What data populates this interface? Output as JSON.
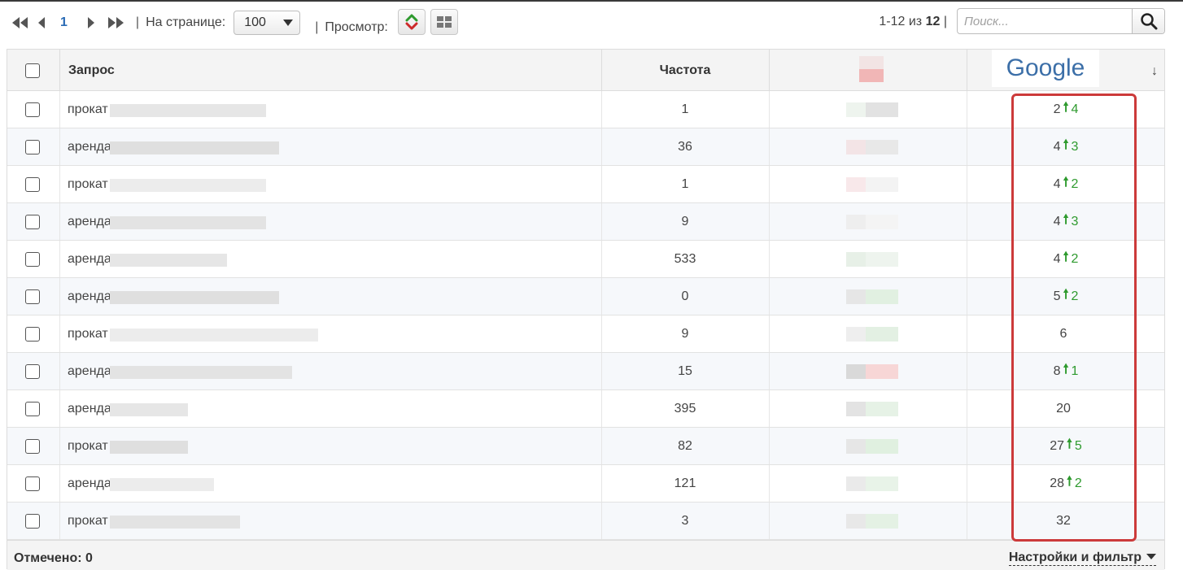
{
  "pager": {
    "current_page": "1",
    "per_page_label": "На странице:",
    "per_page_value": "100",
    "view_label": "Просмотр:",
    "separator": "|"
  },
  "counter": {
    "range": "1-12 из",
    "total": "12",
    "sep": "|"
  },
  "search": {
    "placeholder": "Поиск..."
  },
  "table": {
    "headers": {
      "query": "Запрос",
      "frequency": "Частота",
      "google": "Google",
      "sort": "↓"
    },
    "rows": [
      {
        "query": "прокат",
        "frequency": "1",
        "position": "2",
        "arrow": "🠕",
        "delta": "4"
      },
      {
        "query": "аренда",
        "frequency": "36",
        "position": "4",
        "arrow": "🠕",
        "delta": "3"
      },
      {
        "query": "прокат",
        "frequency": "1",
        "position": "4",
        "arrow": "🠕",
        "delta": "2"
      },
      {
        "query": "аренда",
        "frequency": "9",
        "position": "4",
        "arrow": "🠕",
        "delta": "3"
      },
      {
        "query": "аренда",
        "frequency": "533",
        "position": "4",
        "arrow": "🠕",
        "delta": "2"
      },
      {
        "query": "аренда",
        "frequency": "0",
        "position": "5",
        "arrow": "🠕",
        "delta": "2"
      },
      {
        "query": "прокат",
        "frequency": "9",
        "position": "6",
        "arrow": "",
        "delta": ""
      },
      {
        "query": "аренда",
        "frequency": "15",
        "position": "8",
        "arrow": "🠕",
        "delta": "1"
      },
      {
        "query": "аренда",
        "frequency": "395",
        "position": "20",
        "arrow": "",
        "delta": ""
      },
      {
        "query": "прокат",
        "frequency": "82",
        "position": "27",
        "arrow": "🠕",
        "delta": "5"
      },
      {
        "query": "аренда",
        "frequency": "121",
        "position": "28",
        "arrow": "🠕",
        "delta": "2"
      },
      {
        "query": "прокат",
        "frequency": "3",
        "position": "32",
        "arrow": "",
        "delta": ""
      }
    ]
  },
  "footer": {
    "marked": "Отмечено: 0",
    "settings": "Настройки и фильтр"
  },
  "colors": {
    "accent": "#2a6bb5",
    "highlight": "#cc3a3a",
    "up": "#2e9a2e"
  }
}
